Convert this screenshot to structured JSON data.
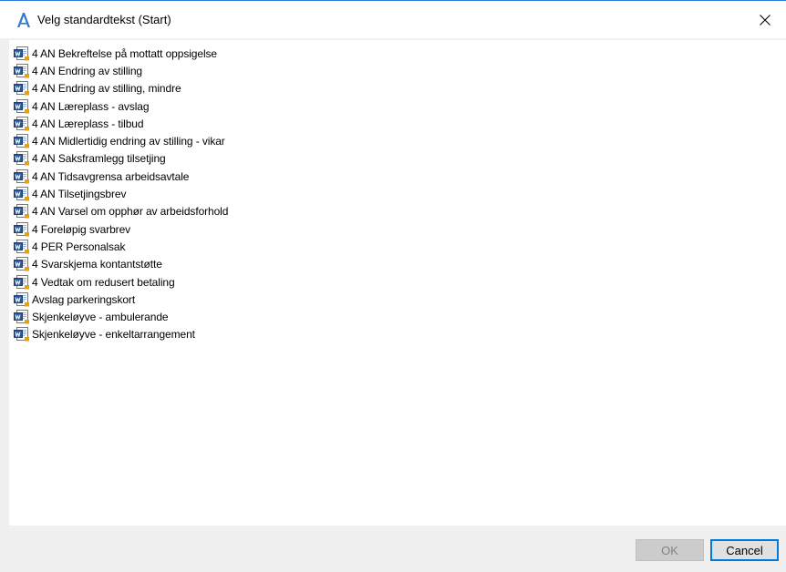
{
  "window": {
    "title": "Velg standardtekst (Start)",
    "app_icon": "stylized-letter-a-icon",
    "accent_color": "#2b79d0"
  },
  "list": {
    "item_icon": "word-document-icon",
    "items": [
      {
        "label": "4 AN Bekreftelse på mottatt oppsigelse"
      },
      {
        "label": "4 AN Endring av stilling"
      },
      {
        "label": "4 AN Endring av stilling, mindre"
      },
      {
        "label": "4 AN Læreplass - avslag"
      },
      {
        "label": "4 AN Læreplass - tilbud"
      },
      {
        "label": "4 AN Midlertidig endring av stilling - vikar"
      },
      {
        "label": "4 AN Saksframlegg tilsetjing"
      },
      {
        "label": "4 AN Tidsavgrensa arbeidsavtale"
      },
      {
        "label": "4 AN Tilsetjingsbrev"
      },
      {
        "label": "4 AN Varsel om opphør av arbeidsforhold"
      },
      {
        "label": "4 Foreløpig svarbrev"
      },
      {
        "label": "4 PER Personalsak"
      },
      {
        "label": "4 Svarskjema kontantstøtte"
      },
      {
        "label": "4 Vedtak om redusert betaling"
      },
      {
        "label": "Avslag parkeringskort"
      },
      {
        "label": "Skjenkeløyve - ambulerande"
      },
      {
        "label": "Skjenkeløyve - enkeltarrangement"
      }
    ]
  },
  "buttons": {
    "ok_label": "OK",
    "cancel_label": "Cancel"
  }
}
